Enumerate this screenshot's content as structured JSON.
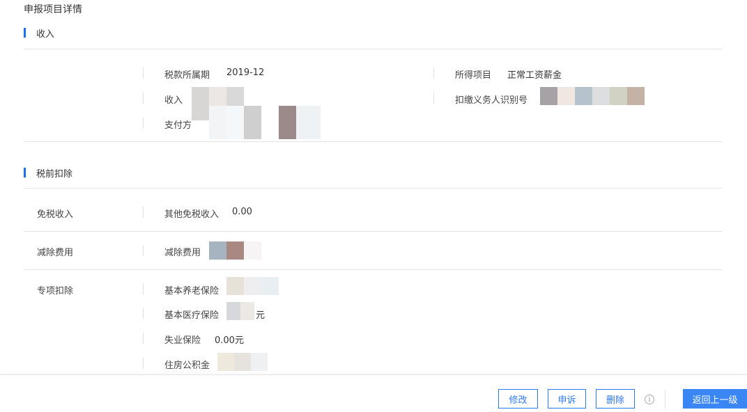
{
  "page": {
    "title": "申报项目详情"
  },
  "income_section": {
    "heading": "收入",
    "tax_period_label": "税款所属期",
    "tax_period_value": "2019-12",
    "income_item_label": "所得项目",
    "income_item_value": "正常工资薪金",
    "income_label": "收入",
    "withholder_id_label": "扣缴义务人识别号",
    "payer_label": "支付方"
  },
  "deduction_section": {
    "heading": "税前扣除",
    "tax_free_row_label": "免税收入",
    "other_tax_free_label": "其他免税收入",
    "other_tax_free_value": "0.00",
    "reduction_row_label": "减除费用",
    "reduction_label": "减除费用",
    "special_row_label": "专项扣除",
    "pension_label": "基本养老保险",
    "medical_label": "基本医疗保险",
    "medical_suffix": "元",
    "unemployment_label": "失业保险",
    "unemployment_value": "0.00元",
    "housing_fund_label": "住房公积金"
  },
  "footer": {
    "modify": "修改",
    "appeal": "申诉",
    "delete": "删除",
    "info_glyph": "i",
    "back": "返回上一级"
  },
  "colors": {
    "accent": "#1e6ff0",
    "button_border": "#2d7af5",
    "primary_button": "#3a86f5"
  },
  "icons": {
    "info": "info-circle-icon"
  }
}
